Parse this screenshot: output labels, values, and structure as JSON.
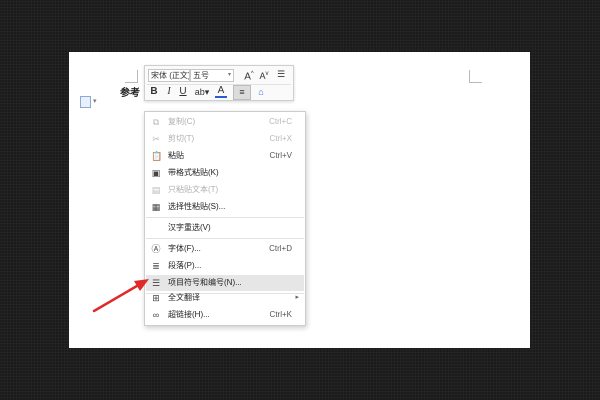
{
  "document": {
    "fragment_text": "参考"
  },
  "mini_toolbar": {
    "font_name": "宋体 (正文)",
    "font_size": "五号",
    "grow_font": "A",
    "shrink_font": "A",
    "bold": "B",
    "italic": "I",
    "underline": "U",
    "font_color": "A"
  },
  "context_menu": {
    "items": [
      {
        "label": "复制(C)",
        "shortcut": "Ctrl+C",
        "icon": "copy-icon"
      },
      {
        "label": "剪切(T)",
        "shortcut": "Ctrl+X",
        "icon": "cut-icon"
      },
      {
        "label": "粘贴",
        "shortcut": "Ctrl+V",
        "icon": "paste-icon"
      },
      {
        "label": "带格式粘贴(K)",
        "shortcut": "",
        "icon": "paste-format-icon"
      },
      {
        "label": "只粘贴文本(T)",
        "shortcut": "",
        "icon": "paste-text-icon"
      },
      {
        "label": "选择性粘贴(S)...",
        "shortcut": "",
        "icon": "paste-special-icon"
      },
      {
        "label": "汉字重选(V)",
        "shortcut": "",
        "icon": ""
      },
      {
        "label": "字体(F)...",
        "shortcut": "Ctrl+D",
        "icon": "font-icon"
      },
      {
        "label": "段落(P)...",
        "shortcut": "",
        "icon": "paragraph-icon"
      },
      {
        "label": "项目符号和编号(N)...",
        "shortcut": "",
        "icon": "bullets-icon"
      },
      {
        "label": "全文翻译",
        "shortcut": "",
        "icon": "translate-icon"
      },
      {
        "label": "超链接(H)...",
        "shortcut": "Ctrl+K",
        "icon": "hyperlink-icon"
      }
    ]
  },
  "colors": {
    "highlight": "#e6e6e6",
    "arrow": "#e02a2a"
  }
}
